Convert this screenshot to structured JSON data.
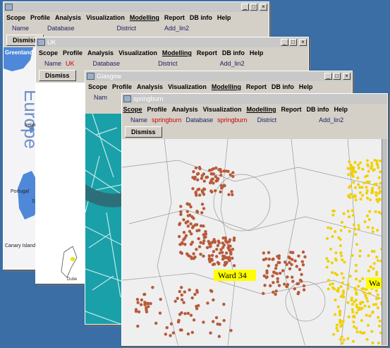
{
  "menu": [
    "Scope",
    "Profile",
    "Analysis",
    "Visualization",
    "Modelling",
    "Report",
    "DB info",
    "Help"
  ],
  "dismiss_label": "Dismiss",
  "field_labels": {
    "name": "Name",
    "database": "Database",
    "district": "District",
    "add": "Add_lin2"
  },
  "windows": {
    "europe": {
      "title": "",
      "map_title": "Europe",
      "labels": {
        "greenland": "Greenland",
        "ireland": "Irelan",
        "portugal": "Portugal",
        "spain": "Sp",
        "canary": "Canary Island"
      }
    },
    "uk": {
      "title": "UK",
      "name_value": "UK",
      "place": "Dube"
    },
    "glasgow": {
      "title": "Glasgow",
      "name_label": "Nam"
    },
    "springburn": {
      "title": "springburn",
      "name_value": "springburn",
      "db_value": "springburn",
      "add_label": "Add_lin2",
      "ward_label": "Ward 34",
      "ward_partial": "Wa"
    }
  },
  "colors": {
    "desktop": "#3a6ea5",
    "window": "#d4d0c8",
    "ward_red": "#b85a3a",
    "ward_yellow": "#f0d000",
    "sea": "#1aa0a8"
  }
}
